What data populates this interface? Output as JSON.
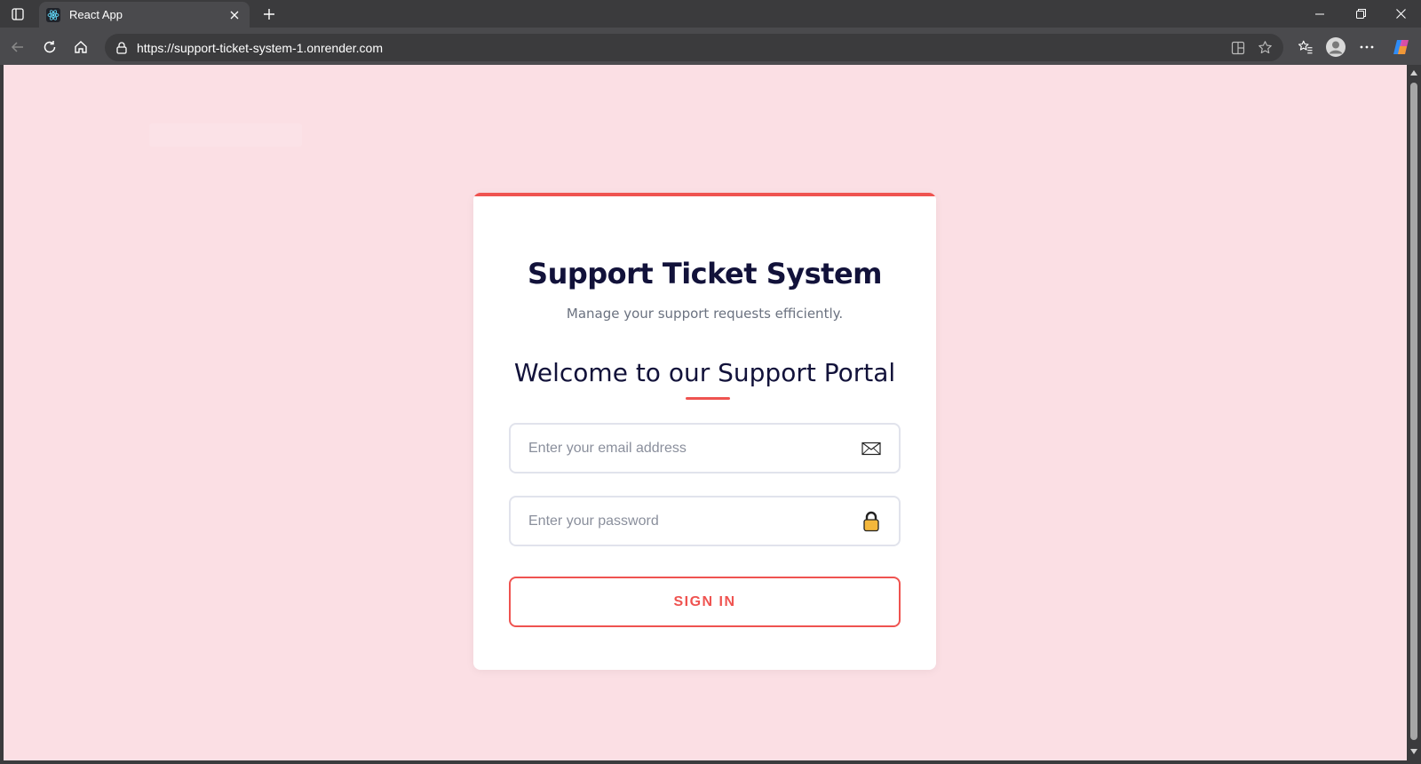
{
  "browser": {
    "tab": {
      "title": "React App",
      "favicon": "react-logo-icon"
    },
    "address_bar": {
      "url": "https://support-ticket-system-1.onrender.com"
    }
  },
  "login": {
    "title": "Support Ticket System",
    "subtitle": "Manage your support requests efficiently.",
    "heading": "Welcome to our Support Portal",
    "email": {
      "placeholder": "Enter your email address",
      "value": ""
    },
    "password": {
      "placeholder": "Enter your password",
      "value": ""
    },
    "submit_label": "SIGN IN"
  },
  "colors": {
    "page_background": "#fbdfe4",
    "accent": "#ef5350",
    "title_text": "#12123a",
    "card_background": "#ffffff"
  }
}
